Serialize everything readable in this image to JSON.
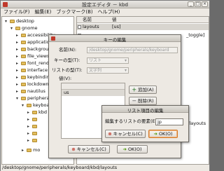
{
  "window": {
    "title": "設定エディタ － kbd"
  },
  "menu": [
    "ファイル(F)",
    "編集(E)",
    "ブックマーク(B)",
    "ヘルプ(H)"
  ],
  "tree": [
    {
      "label": "desktop",
      "expanded": true
    },
    {
      "label": "gnome",
      "expanded": true
    },
    {
      "label": "accessibility",
      "expanded": false
    },
    {
      "label": "applications",
      "expanded": false
    },
    {
      "label": "background",
      "expanded": false
    },
    {
      "label": "file_views",
      "expanded": false
    },
    {
      "label": "font_rendering",
      "expanded": false
    },
    {
      "label": "interface",
      "expanded": false
    },
    {
      "label": "keybindings",
      "expanded": false
    },
    {
      "label": "lockdown",
      "expanded": false
    },
    {
      "label": "nautilus",
      "expanded": false
    },
    {
      "label": "peripherals",
      "expanded": true
    },
    {
      "label": "keyboard",
      "expanded": true
    },
    {
      "label": "kbd",
      "expanded": false
    },
    {
      "label": "",
      "expanded": false
    },
    {
      "label": "",
      "expanded": false
    },
    {
      "label": "",
      "expanded": false
    },
    {
      "label": "",
      "expanded": false
    },
    {
      "label": "mo",
      "expanded": false
    }
  ],
  "list": {
    "headers": [
      "名前",
      "値"
    ],
    "rows": [
      {
        "name": "layouts",
        "value": "[us]",
        "selected": true
      },
      {
        "name": "",
        "value": "_toggle]",
        "selected": false
      }
    ]
  },
  "status": "/desktop/gnome/peripherals/keyboard/kbd/layouts",
  "key_dialog": {
    "title": "キーの編集",
    "name_label": "名前(N):",
    "name_value": "/desktop/gnome/peripherals/keyboard",
    "type_label": "キーの型(T):",
    "type_value": "リスト",
    "list_type_label": "リストの型(T):",
    "list_type_value": "文字列",
    "values_label": "値(V):",
    "values": [
      "us"
    ],
    "add_button": "追加(A)",
    "delete_button": "削除(R)",
    "cancel_button": "キャンセル(C)",
    "ok_button": "OK(O)"
  },
  "list_dialog": {
    "title": "リスト項目の編集",
    "label": "編集するリストの要素(E):",
    "value": "jp",
    "cancel_button": "キャンセル(C)",
    "ok_button": "OK(O)"
  },
  "right_partial": "bd/layouts"
}
